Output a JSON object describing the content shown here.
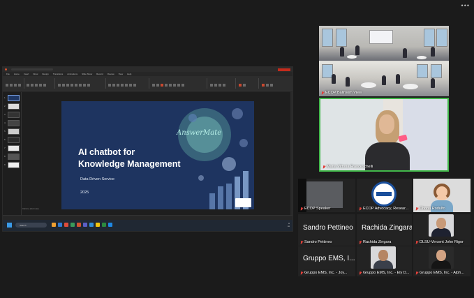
{
  "meeting": {
    "more_menu": "•••"
  },
  "shared_screen": {
    "app": "PowerPoint",
    "ribbon_tabs": [
      "File",
      "Home",
      "Insert",
      "Draw",
      "Design",
      "Transitions",
      "Animations",
      "Slide Show",
      "Record",
      "Review",
      "View",
      "Help"
    ],
    "slide": {
      "title_line1": "AI chatbot for",
      "title_line2": "Knowledge Management",
      "subtitle": "Data Driven Service",
      "year": "2025",
      "logo_text": "AnswerMate"
    },
    "notes_hint": "Click to add notes",
    "taskbar_search": "Search",
    "accent_color": "#1e3460"
  },
  "participants": {
    "ballroom": "ECOP Ballroom View",
    "active_speaker": "Maria Vittoria Franceschelli",
    "active_border_color": "#42b84a",
    "row1": [
      {
        "name": "ECOP Speaker"
      },
      {
        "name": "ECOP Advocacy, Resear..."
      },
      {
        "name": "Chona Rodulfo"
      }
    ],
    "row2": [
      {
        "display": "Sandro Pettineo",
        "name": "Sandro Pettineo"
      },
      {
        "display": "Rachida Zingara",
        "name": "Rachida Zingara"
      },
      {
        "display": "",
        "name": "DLSU-Vincent John Rigor"
      }
    ],
    "row3": [
      {
        "display": "Gruppo EMS, I...",
        "name": "Gruppo EMS, Inc. - Joy..."
      },
      {
        "display": "",
        "name": "Gruppo EMS, Inc. - Ely D..."
      },
      {
        "display": "",
        "name": "Gruppo EMS, Inc. - Alph..."
      }
    ]
  }
}
